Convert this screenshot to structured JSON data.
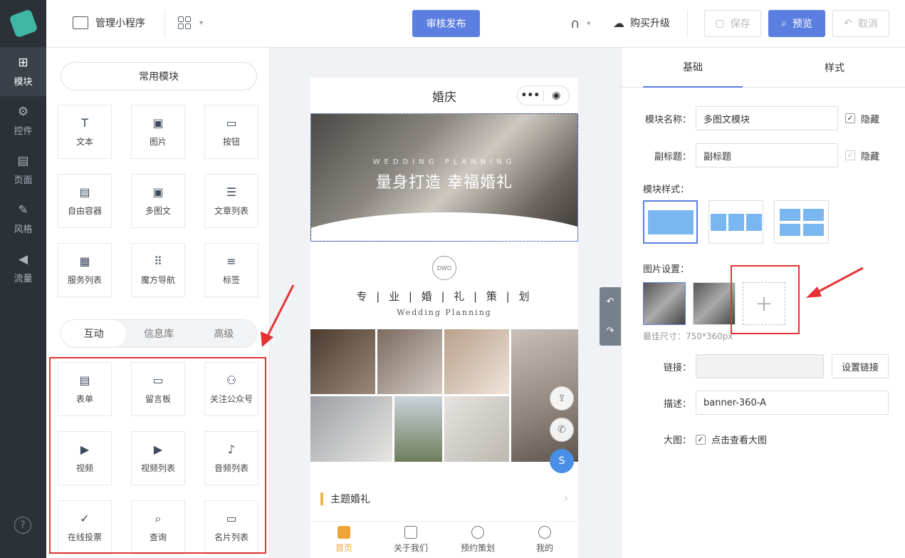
{
  "nav": {
    "items": [
      {
        "label": "模块",
        "icon": "plus-square-icon",
        "active": true
      },
      {
        "label": "控件",
        "icon": "sliders-icon",
        "active": false
      },
      {
        "label": "页面",
        "icon": "page-list-icon",
        "active": false
      },
      {
        "label": "风格",
        "icon": "magic-wand-icon",
        "active": false
      },
      {
        "label": "流量",
        "icon": "megaphone-icon",
        "active": false
      }
    ],
    "help": "?"
  },
  "topbar": {
    "app_label": "管理小程序",
    "publish_label": "审核发布",
    "upgrade_label": "购买升级",
    "save_label": "保存",
    "preview_label": "预览",
    "cancel_label": "取消"
  },
  "modules": {
    "common_label": "常用模块",
    "common": [
      {
        "label": "文本",
        "icon": "text-icon"
      },
      {
        "label": "图片",
        "icon": "image-icon"
      },
      {
        "label": "按钮",
        "icon": "button-icon"
      },
      {
        "label": "自由容器",
        "icon": "container-icon"
      },
      {
        "label": "多图文",
        "icon": "multi-image-text-icon"
      },
      {
        "label": "文章列表",
        "icon": "article-list-icon"
      },
      {
        "label": "服务列表",
        "icon": "service-list-icon"
      },
      {
        "label": "魔方导航",
        "icon": "cube-nav-icon"
      },
      {
        "label": "标签",
        "icon": "tag-icon"
      }
    ],
    "tabs": [
      "互动",
      "信息库",
      "高级"
    ],
    "active_tab": "互动",
    "interactive": [
      {
        "label": "表单",
        "icon": "form-icon"
      },
      {
        "label": "留言板",
        "icon": "message-board-icon"
      },
      {
        "label": "关注公众号",
        "icon": "follow-user-icon"
      },
      {
        "label": "视频",
        "icon": "video-icon"
      },
      {
        "label": "视频列表",
        "icon": "video-list-icon"
      },
      {
        "label": "音频列表",
        "icon": "audio-list-icon"
      },
      {
        "label": "在线投票",
        "icon": "vote-icon"
      },
      {
        "label": "查询",
        "icon": "search-doc-icon"
      },
      {
        "label": "名片列表",
        "icon": "card-list-icon"
      }
    ]
  },
  "phone": {
    "title": "婚庆",
    "banner_sub": "WEDDING PLANNING",
    "banner_title": "量身打造 幸福婚礼",
    "logo_text": "DWO",
    "section_cn": "专 | 业 | 婚 | 礼 | 策 | 划",
    "section_en": "Wedding Planning",
    "theme_label": "主题婚礼",
    "tabbar": [
      "首页",
      "关于我们",
      "预约策划",
      "我的"
    ]
  },
  "props": {
    "tabs": [
      "基础",
      "样式"
    ],
    "active_tab": "基础",
    "module_name_label": "模块名称：",
    "module_name_value": "多图文模块",
    "hide_label": "隐藏",
    "subtitle_label": "副标题：",
    "subtitle_value": "副标题",
    "style_label": "模块样式：",
    "image_setting_label": "图片设置：",
    "best_size": "最佳尺寸：750*360px",
    "link_label": "链接：",
    "link_value": "",
    "set_link_label": "设置链接",
    "desc_label": "描述：",
    "desc_value": "banner-360-A",
    "bigimg_label": "大图：",
    "bigimg_check_label": "点击查看大图"
  },
  "colors": {
    "primary": "#5b7fe0",
    "highlight": "#e53333",
    "accent": "#f0a43a"
  }
}
